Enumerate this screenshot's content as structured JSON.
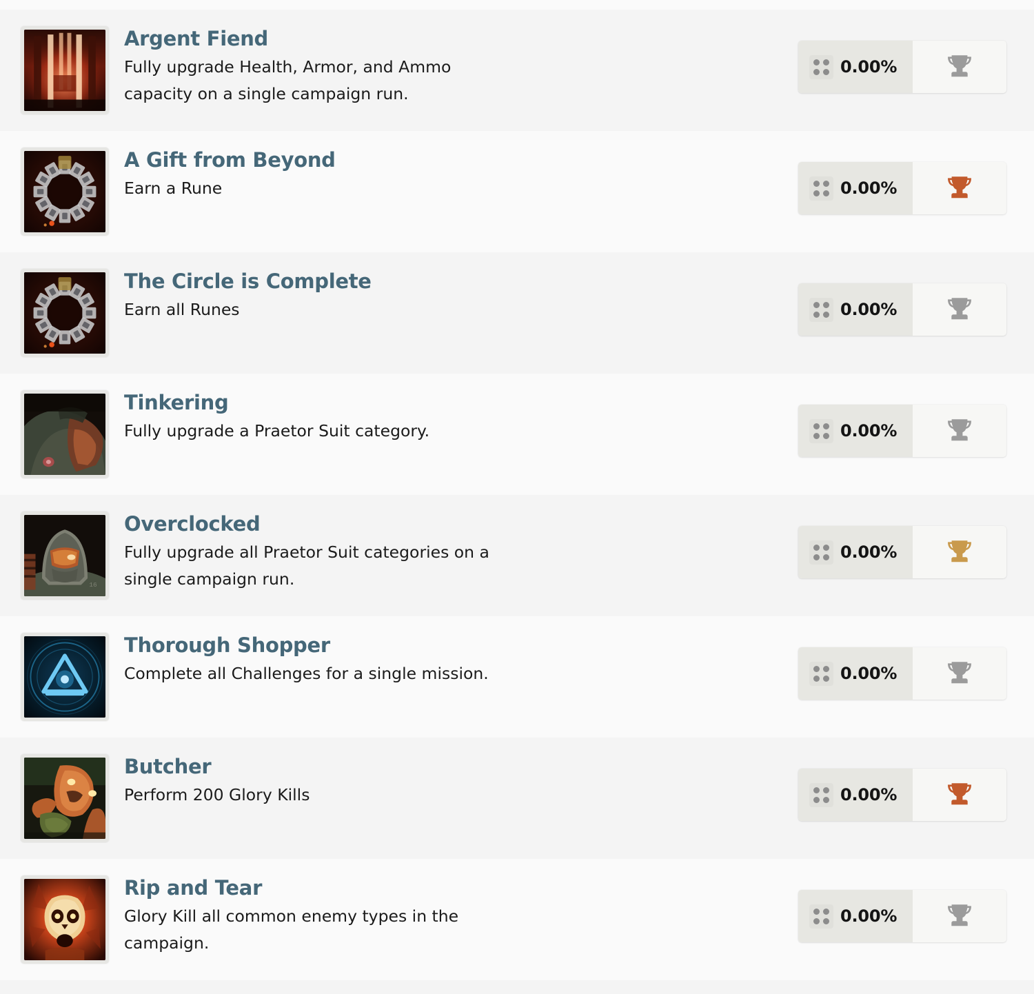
{
  "list": {
    "name": "achievement-list",
    "progress_label": "0.00%",
    "trophy_colors": {
      "default": "#9b9b9b",
      "bronze": "#c25a2c",
      "gold": "#c99a4d"
    },
    "accent_title_color": "#456778",
    "row_bg_dark": "#f4f4f4",
    "row_bg_light": "#fafafa",
    "items": [
      {
        "title": "Argent Fiend",
        "description": "Fully upgrade Health, Armor, and Ammo capacity on a single campaign run.",
        "progress": "0.00%",
        "trophy": "default",
        "icon": "argent-tower-thumbnail"
      },
      {
        "title": "A Gift from Beyond",
        "description": "Earn a Rune",
        "progress": "0.00%",
        "trophy": "bronze",
        "icon": "rune-circle-thumbnail"
      },
      {
        "title": "The Circle is Complete",
        "description": "Earn all Runes",
        "progress": "0.00%",
        "trophy": "default",
        "icon": "rune-circle-thumbnail"
      },
      {
        "title": "Tinkering",
        "description": "Fully upgrade a Praetor Suit category.",
        "progress": "0.00%",
        "trophy": "default",
        "icon": "praetor-suit-thumbnail"
      },
      {
        "title": "Overclocked",
        "description": "Fully upgrade all Praetor Suit categories on a single campaign run.",
        "progress": "0.00%",
        "trophy": "gold",
        "icon": "doom-slayer-helmet-thumbnail"
      },
      {
        "title": "Thorough Shopper",
        "description": "Complete all Challenges for a single mission.",
        "progress": "0.00%",
        "trophy": "default",
        "icon": "blue-triangle-hologram-thumbnail"
      },
      {
        "title": "Butcher",
        "description": "Perform 200 Glory Kills",
        "progress": "0.00%",
        "trophy": "bronze",
        "icon": "possessed-demon-thumbnail"
      },
      {
        "title": "Rip and Tear",
        "description": "Glory Kill all common enemy types in the campaign.",
        "progress": "0.00%",
        "trophy": "default",
        "icon": "burning-skull-thumbnail"
      }
    ]
  }
}
